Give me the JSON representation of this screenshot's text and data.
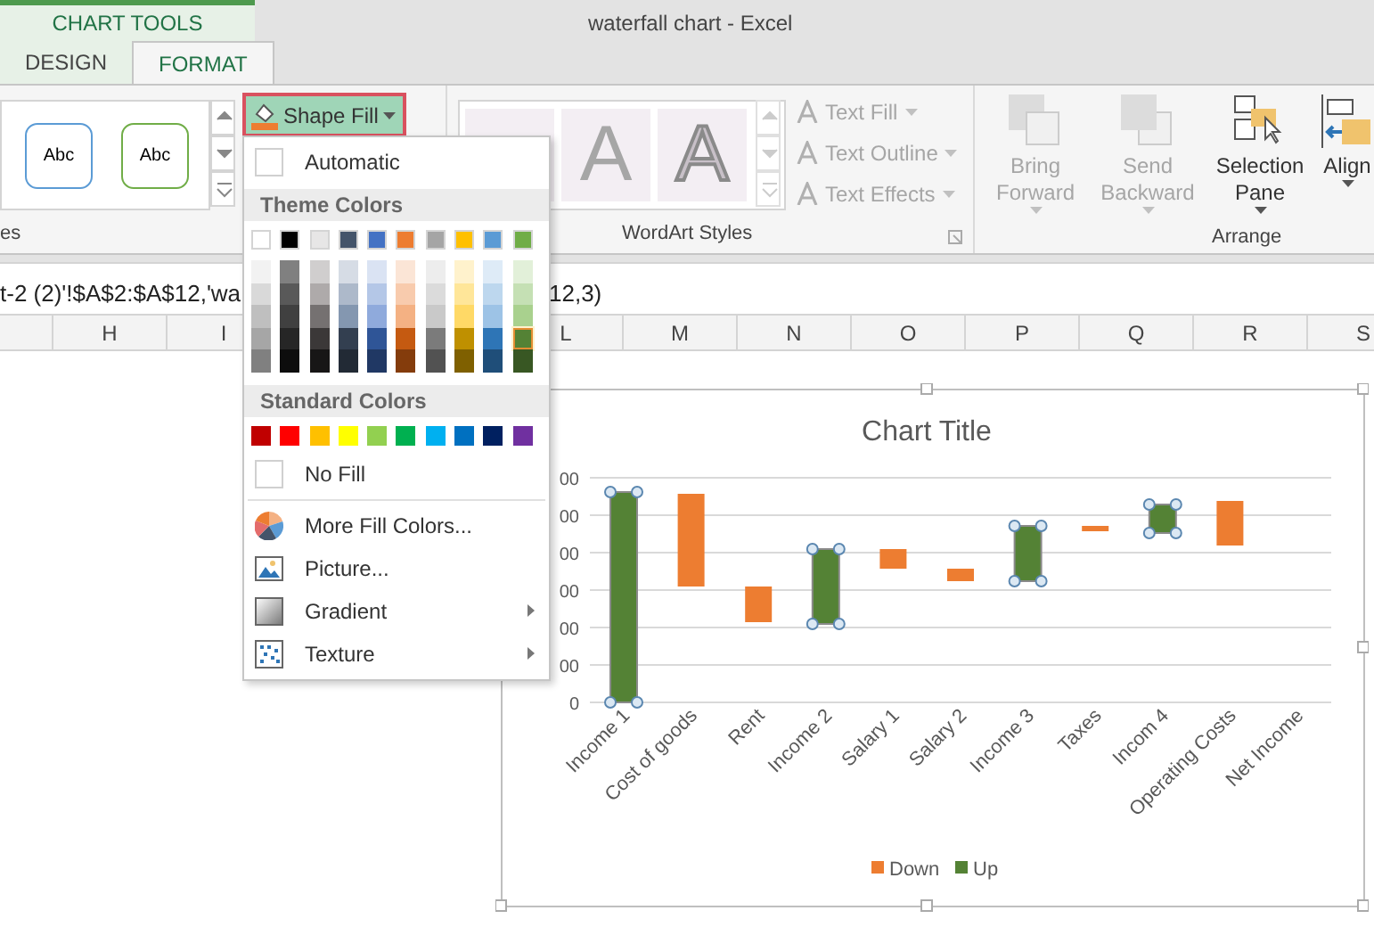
{
  "window": {
    "title": "waterfall chart - Excel"
  },
  "contextual_group": "CHART TOOLS",
  "tabs": [
    {
      "label": "DESIGN",
      "selected": false
    },
    {
      "label": "FORMAT",
      "selected": true
    }
  ],
  "ribbon": {
    "shape_styles": {
      "samples": [
        {
          "label": "Abc",
          "color": "#5b9bd5"
        },
        {
          "label": "Abc",
          "color": "#70ad47"
        }
      ],
      "group_label": "es"
    },
    "shape_fill": {
      "label": "Shape Fill",
      "expanded": true
    },
    "wordart_styles": {
      "samples": [
        "A",
        "A"
      ],
      "commands": [
        {
          "label": "Text Fill",
          "disabled": true
        },
        {
          "label": "Text Outline",
          "disabled": true
        },
        {
          "label": "Text Effects",
          "disabled": true
        }
      ],
      "group_label": "WordArt Styles"
    },
    "arrange": {
      "commands": [
        {
          "label": "Bring Forward",
          "disabled": true
        },
        {
          "label": "Send Backward",
          "disabled": true
        },
        {
          "label": "Selection Pane",
          "disabled": false
        },
        {
          "label": "Align",
          "disabled": false
        }
      ],
      "group_label": "Arrange"
    }
  },
  "formula_bar": {
    "visible_start": "t-2 (2)'!$A$2:$A$12,'wa",
    "visible_end": "12,3)"
  },
  "column_headers": [
    "H",
    "I",
    "L",
    "M",
    "N",
    "O",
    "P",
    "Q",
    "R",
    "S"
  ],
  "fill_menu": {
    "automatic": "Automatic",
    "theme_header": "Theme Colors",
    "theme_base": [
      {
        "color": "#ffffff"
      },
      {
        "color": "#000000"
      },
      {
        "color": "#e7e6e6"
      },
      {
        "color": "#44546a"
      },
      {
        "color": "#4472c4"
      },
      {
        "color": "#ed7d31"
      },
      {
        "color": "#a5a5a5"
      },
      {
        "color": "#ffc000"
      },
      {
        "color": "#5b9bd5"
      },
      {
        "color": "#70ad47"
      }
    ],
    "theme_shades": [
      [
        {
          "color": "#f2f2f2",
          "selected": false
        },
        {
          "color": "#d9d9d9",
          "selected": false
        },
        {
          "color": "#bfbfbf",
          "selected": false
        },
        {
          "color": "#a6a6a6",
          "selected": false
        },
        {
          "color": "#808080",
          "selected": false
        }
      ],
      [
        {
          "color": "#808080",
          "selected": false
        },
        {
          "color": "#595959",
          "selected": false
        },
        {
          "color": "#404040",
          "selected": false
        },
        {
          "color": "#262626",
          "selected": false
        },
        {
          "color": "#0d0d0d",
          "selected": false
        }
      ],
      [
        {
          "color": "#d0cece",
          "selected": false
        },
        {
          "color": "#aeaaaa",
          "selected": false
        },
        {
          "color": "#757171",
          "selected": false
        },
        {
          "color": "#3b3838",
          "selected": false
        },
        {
          "color": "#171616",
          "selected": false
        }
      ],
      [
        {
          "color": "#d6dce5",
          "selected": false
        },
        {
          "color": "#adb9ca",
          "selected": false
        },
        {
          "color": "#8497b0",
          "selected": false
        },
        {
          "color": "#333f50",
          "selected": false
        },
        {
          "color": "#222a35",
          "selected": false
        }
      ],
      [
        {
          "color": "#dae3f3",
          "selected": false
        },
        {
          "color": "#b4c7e7",
          "selected": false
        },
        {
          "color": "#8faadc",
          "selected": false
        },
        {
          "color": "#2f5597",
          "selected": false
        },
        {
          "color": "#203864",
          "selected": false
        }
      ],
      [
        {
          "color": "#fbe5d6",
          "selected": false
        },
        {
          "color": "#f8cbad",
          "selected": false
        },
        {
          "color": "#f4b183",
          "selected": false
        },
        {
          "color": "#c55a11",
          "selected": false
        },
        {
          "color": "#843c0c",
          "selected": false
        }
      ],
      [
        {
          "color": "#ededed",
          "selected": false
        },
        {
          "color": "#dbdbdb",
          "selected": false
        },
        {
          "color": "#c9c9c9",
          "selected": false
        },
        {
          "color": "#7b7b7b",
          "selected": false
        },
        {
          "color": "#525252",
          "selected": false
        }
      ],
      [
        {
          "color": "#fff2cc",
          "selected": false
        },
        {
          "color": "#ffe699",
          "selected": false
        },
        {
          "color": "#ffd966",
          "selected": false
        },
        {
          "color": "#bf9000",
          "selected": false
        },
        {
          "color": "#7f6000",
          "selected": false
        }
      ],
      [
        {
          "color": "#deebf7",
          "selected": false
        },
        {
          "color": "#bdd7ee",
          "selected": false
        },
        {
          "color": "#9dc3e6",
          "selected": false
        },
        {
          "color": "#2e75b6",
          "selected": false
        },
        {
          "color": "#1f4e79",
          "selected": false
        }
      ],
      [
        {
          "color": "#e2f0d9",
          "selected": false
        },
        {
          "color": "#c5e0b4",
          "selected": false
        },
        {
          "color": "#a9d18e",
          "selected": false
        },
        {
          "color": "#548235",
          "selected": true
        },
        {
          "color": "#385723",
          "selected": false
        }
      ]
    ],
    "standard_header": "Standard Colors",
    "standard": [
      {
        "color": "#c00000"
      },
      {
        "color": "#ff0000"
      },
      {
        "color": "#ffc000"
      },
      {
        "color": "#ffff00"
      },
      {
        "color": "#92d050"
      },
      {
        "color": "#00b050"
      },
      {
        "color": "#00b0f0"
      },
      {
        "color": "#0070c0"
      },
      {
        "color": "#002060"
      },
      {
        "color": "#7030a0"
      }
    ],
    "no_fill": "No Fill",
    "items": [
      {
        "label": "More Fill Colors...",
        "kind": "colors",
        "submenu": false
      },
      {
        "label": "Picture...",
        "kind": "picture",
        "submenu": false
      },
      {
        "label": "Gradient",
        "kind": "gradient",
        "submenu": true
      },
      {
        "label": "Texture",
        "kind": "texture",
        "submenu": true
      }
    ]
  },
  "chart": {
    "title": "Chart Title",
    "y_tick_labels": [
      "00",
      "00",
      "00",
      "00",
      "00",
      "00",
      "0"
    ],
    "categories": [
      "Income 1",
      "Cost of goods",
      "Rent",
      "Income 2",
      "Salary 1",
      "Salary 2",
      "Income 3",
      "Taxes",
      "Incom 4",
      "Operating Costs",
      "Net Income"
    ],
    "legend": [
      {
        "label": "Down",
        "color": "#ed7d31"
      },
      {
        "label": "Up",
        "color": "#548235"
      }
    ]
  }
}
